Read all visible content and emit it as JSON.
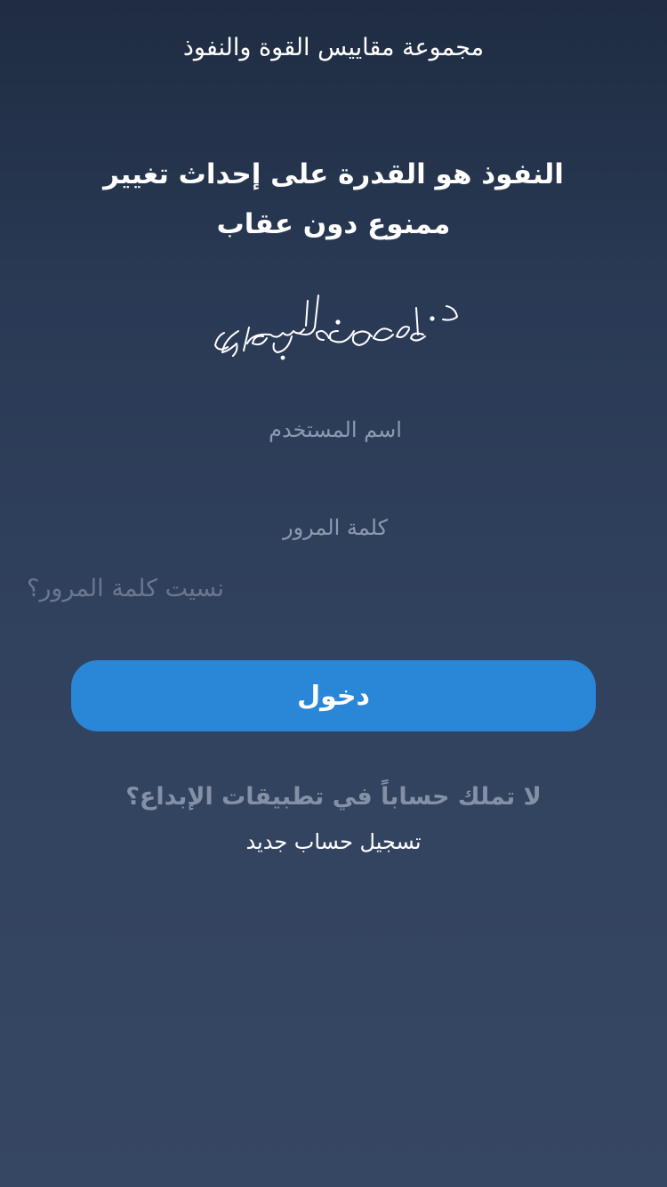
{
  "header": {
    "app_title": "مجموعة مقاييس القوة والنفوذ"
  },
  "quote": {
    "line1": "النفوذ هو القدرة على إحداث تغيير",
    "line2": "ممنوع دون عقاب"
  },
  "signature": {
    "text": "د. طارق محمد السويدان"
  },
  "form": {
    "username_placeholder": "اسم المستخدم",
    "password_placeholder": "كلمة المرور",
    "forgot_label": "نسيت كلمة المرور؟",
    "login_label": "دخول"
  },
  "footer": {
    "no_account_text": "لا تملك حساباً في تطبيقات الإبداع؟",
    "register_label": "تسجيل حساب جديد"
  },
  "colors": {
    "background_top": "#1f2c42",
    "background_bottom": "#364763",
    "button": "#2a86d6",
    "muted_text": "#8390a6"
  }
}
